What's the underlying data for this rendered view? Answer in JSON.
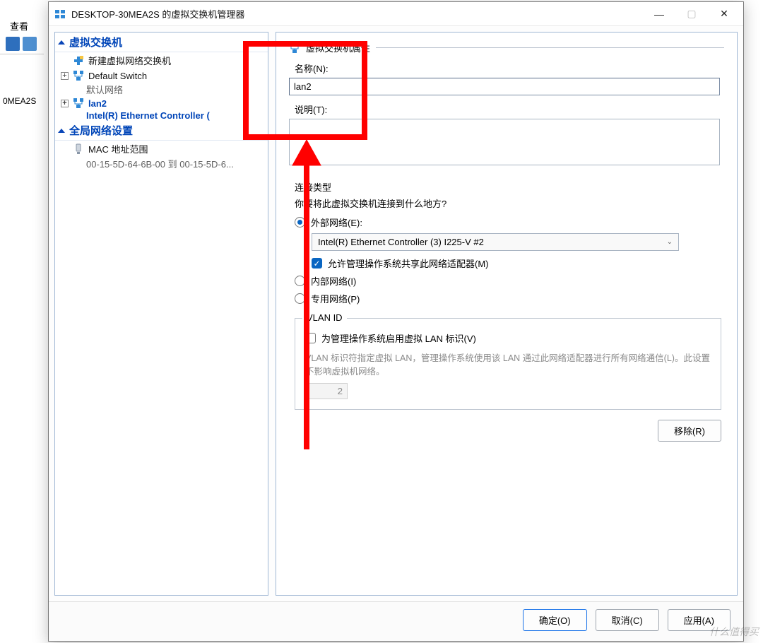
{
  "background": {
    "menubar_view": "查看(V",
    "tree_node": "0MEA2S"
  },
  "dialog": {
    "title": "DESKTOP-30MEA2S 的虚拟交换机管理器",
    "win_controls": {
      "min": "—",
      "max": "▢",
      "close": "✕"
    }
  },
  "tree": {
    "section_switches": "虚拟交换机",
    "new_switch": "新建虚拟网络交换机",
    "default_switch": "Default Switch",
    "default_switch_sub": "默认网络",
    "lan2": "lan2",
    "lan2_sub": "Intel(R) Ethernet Controller (",
    "section_global": "全局网络设置",
    "mac_range": "MAC 地址范围",
    "mac_range_sub": "00-15-5D-64-6B-00 到 00-15-5D-6..."
  },
  "props": {
    "group_title": "虚拟交换机属性",
    "name_label": "名称(N):",
    "name_value": "lan2",
    "desc_label": "说明(T):",
    "conn_title": "连接类型",
    "conn_prompt": "你要将此虚拟交换机连接到什么地方?",
    "radio_external": "外部网络(E):",
    "external_nic": "Intel(R) Ethernet Controller (3) I225-V #2",
    "allow_mgmt_os": "允许管理操作系统共享此网络适配器(M)",
    "radio_internal": "内部网络(I)",
    "radio_private": "专用网络(P)"
  },
  "vlan": {
    "legend": "VLAN ID",
    "enable_label": "为管理操作系统启用虚拟 LAN 标识(V)",
    "desc": "VLAN 标识符指定虚拟 LAN，管理操作系统使用该 LAN 通过此网络适配器进行所有网络通信(L)。此设置不影响虚拟机网络。",
    "value": "2"
  },
  "buttons": {
    "remove": "移除(R)",
    "ok": "确定(O)",
    "cancel": "取消(C)",
    "apply": "应用(A)"
  },
  "watermark": "什么值得买"
}
